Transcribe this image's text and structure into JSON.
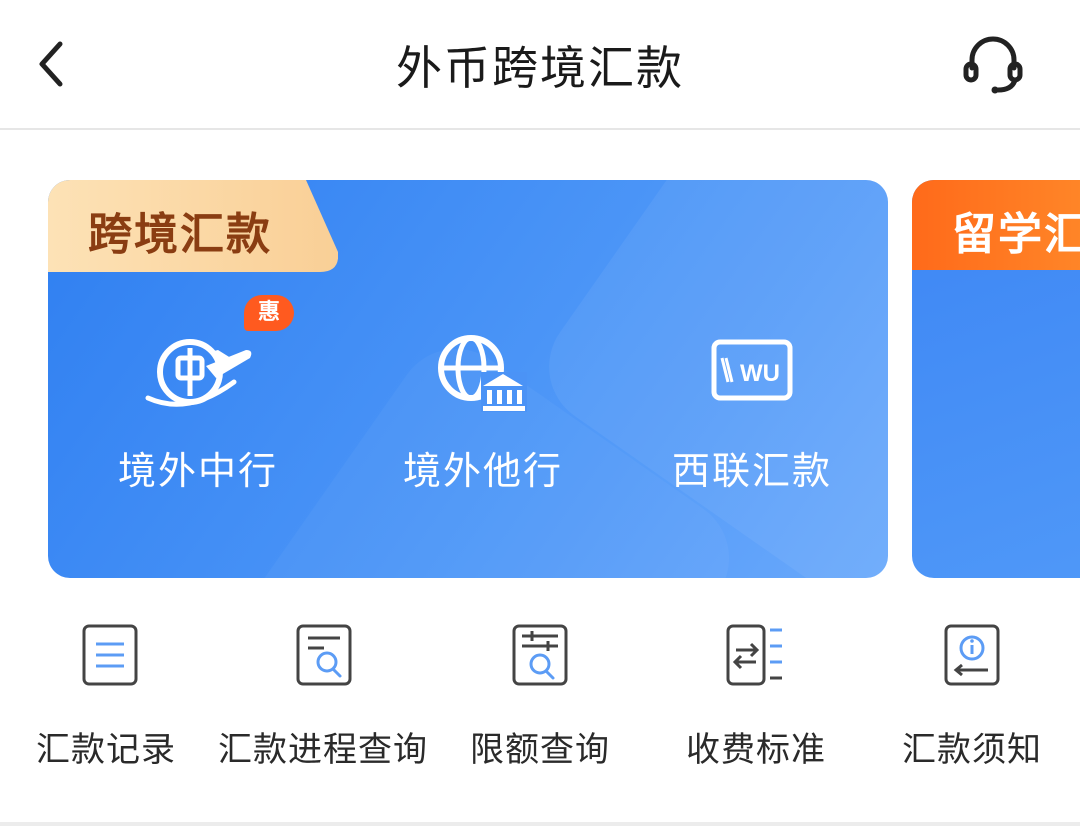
{
  "header": {
    "title": "外币跨境汇款",
    "back_icon": "chevron-left-icon",
    "service_icon": "headset-icon"
  },
  "main_card": {
    "tab_label": "跨境汇款",
    "services": [
      {
        "label": "境外中行",
        "icon": "globe-plane-icon",
        "badge": "惠"
      },
      {
        "label": "境外他行",
        "icon": "globe-bank-icon"
      },
      {
        "label": "西联汇款",
        "icon": "western-union-icon",
        "icon_text": "WU"
      }
    ]
  },
  "second_card": {
    "tab_label": "留学汇"
  },
  "tools": [
    {
      "label": "汇款记录",
      "icon": "record-list-icon"
    },
    {
      "label": "汇款进程查询",
      "icon": "progress-search-icon"
    },
    {
      "label": "限额查询",
      "icon": "limit-search-icon"
    },
    {
      "label": "收费标准",
      "icon": "fee-standard-icon"
    },
    {
      "label": "汇款须知",
      "icon": "notice-info-icon"
    }
  ],
  "colors": {
    "card_blue": "#3d86f4",
    "tab_peach": "#fcd9a8",
    "tab_text": "#8a3d12",
    "tab_orange": "#ff7a22",
    "badge": "#ff5a1f",
    "icon_stroke": "#444444"
  }
}
